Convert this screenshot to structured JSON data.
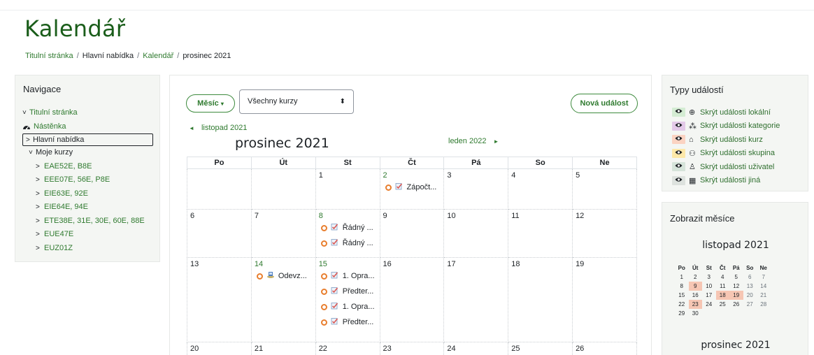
{
  "page": {
    "title": "Kalendář"
  },
  "breadcrumb": [
    {
      "label": "Titulní stránka",
      "link": true
    },
    {
      "label": "Hlavní nabídka",
      "link": false
    },
    {
      "label": "Kalendář",
      "link": true
    },
    {
      "label": "prosinec 2021",
      "link": false
    }
  ],
  "breadcrumb_sep": "/",
  "navigation": {
    "title": "Navigace",
    "items": {
      "home": {
        "label": "Titulní stránka",
        "chev": "˅"
      },
      "dashboard": {
        "label": "Nástěnka",
        "icon": "dashboard-icon"
      },
      "main_menu": {
        "label": "Hlavní nabídka",
        "chev": ">"
      },
      "my_courses": {
        "label": "Moje kurzy",
        "chev": "˅"
      },
      "courses": [
        {
          "label": "EAE52E, B8E",
          "chev": ">"
        },
        {
          "label": "EEE07E, 56E, P8E",
          "chev": ">"
        },
        {
          "label": "EIE63E, 92E",
          "chev": ">"
        },
        {
          "label": "EIE64E, 94E",
          "chev": ">"
        },
        {
          "label": "ETE38E, 31E, 30E, 60E, 88E",
          "chev": ">"
        },
        {
          "label": "EUE47E",
          "chev": ">"
        },
        {
          "label": "EUZ01Z",
          "chev": ">"
        }
      ]
    }
  },
  "calendar": {
    "view_button": "Měsíc",
    "course_select": {
      "value": "Všechny kurzy",
      "arrows": "⬍"
    },
    "new_event_button": "Nová událost",
    "prev_month": {
      "arrow": "◄",
      "label": "listopad 2021"
    },
    "current_month": "prosinec 2021",
    "next_month": {
      "label": "leden 2022",
      "arrow": "►"
    },
    "weekdays": [
      "Po",
      "Út",
      "St",
      "Čt",
      "Pá",
      "So",
      "Ne"
    ],
    "weeks": [
      [
        {
          "day": ""
        },
        {
          "day": ""
        },
        {
          "day": "1"
        },
        {
          "day": "2",
          "events": [
            {
              "icon": "assignment-icon",
              "text": "Zápočt..."
            }
          ]
        },
        {
          "day": "3"
        },
        {
          "day": "4"
        },
        {
          "day": "5"
        }
      ],
      [
        {
          "day": "6"
        },
        {
          "day": "7"
        },
        {
          "day": "8",
          "events": [
            {
              "icon": "assignment-icon",
              "text": "Řádný ..."
            },
            {
              "icon": "assignment-icon",
              "text": "Řádný ..."
            }
          ]
        },
        {
          "day": "9"
        },
        {
          "day": "10"
        },
        {
          "day": "11"
        },
        {
          "day": "12"
        }
      ],
      [
        {
          "day": "13"
        },
        {
          "day": "14",
          "events": [
            {
              "icon": "submission-icon",
              "text": "Odevz..."
            }
          ]
        },
        {
          "day": "15",
          "events": [
            {
              "icon": "assignment-icon",
              "text": "1. Opra..."
            },
            {
              "icon": "assignment-icon",
              "text": "Předter..."
            },
            {
              "icon": "assignment-icon",
              "text": "1. Opra..."
            },
            {
              "icon": "assignment-icon",
              "text": "Předter..."
            }
          ]
        },
        {
          "day": "16"
        },
        {
          "day": "17"
        },
        {
          "day": "18"
        },
        {
          "day": "19"
        }
      ],
      [
        {
          "day": "20"
        },
        {
          "day": "21"
        },
        {
          "day": "22"
        },
        {
          "day": "23"
        },
        {
          "day": "24"
        },
        {
          "day": "25"
        },
        {
          "day": "26"
        }
      ]
    ],
    "event_dot_color": "#e87e2e"
  },
  "event_types": {
    "title": "Typy událostí",
    "items": [
      {
        "label": "Skrýt události lokální",
        "icon": "globe-icon",
        "glyph": "⊕",
        "color": "#d4ecd3"
      },
      {
        "label": "Skrýt události kategorie",
        "icon": "cubes-icon",
        "glyph": "⁂",
        "color": "#e3c9e8"
      },
      {
        "label": "Skrýt události kurz",
        "icon": "graduation-cap-icon",
        "glyph": "⌂",
        "color": "#fbd3c2"
      },
      {
        "label": "Skrýt události skupina",
        "icon": "users-icon",
        "glyph": "⚇",
        "color": "#fde8a8"
      },
      {
        "label": "Skrýt události uživatel",
        "icon": "user-icon",
        "glyph": "♙",
        "color": "#d6e4da"
      },
      {
        "label": "Skrýt události jiná",
        "icon": "calendar-icon",
        "glyph": "▦",
        "color": "#dde2de"
      }
    ]
  },
  "months_panel": {
    "title": "Zobrazit měsíce",
    "month1": "listopad 2021",
    "month2": "prosinec 2021",
    "weekdays": [
      "Po",
      "Út",
      "St",
      "Čt",
      "Pá",
      "So",
      "Ne"
    ],
    "weeks": [
      [
        "1",
        "2",
        "3",
        "4",
        "5",
        "6",
        "7"
      ],
      [
        "8",
        "9",
        "10",
        "11",
        "12",
        "13",
        "14"
      ],
      [
        "15",
        "16",
        "17",
        "18",
        "19",
        "20",
        "21"
      ],
      [
        "22",
        "23",
        "24",
        "25",
        "26",
        "27",
        "28"
      ],
      [
        "29",
        "30",
        "",
        "",
        "",
        "",
        ""
      ]
    ],
    "highlighted_days": [
      "9",
      "18",
      "19",
      "23"
    ],
    "highlight_color": "#f6c6b3"
  }
}
